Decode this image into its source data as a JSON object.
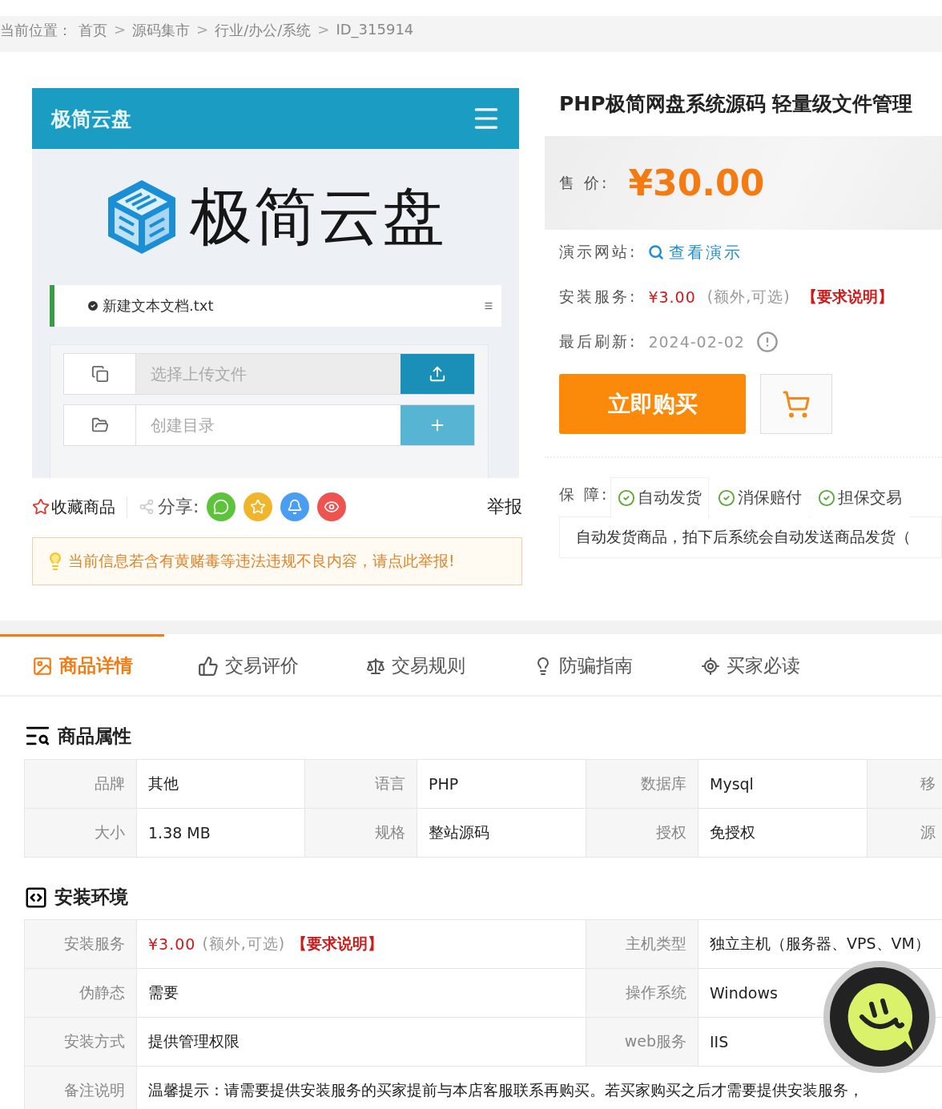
{
  "breadcrumb": {
    "label": "当前位置：",
    "items": [
      {
        "kind": "link",
        "text": "首页"
      },
      {
        "kind": "sep",
        "text": ">"
      },
      {
        "kind": "link",
        "text": "源码集市"
      },
      {
        "kind": "sep",
        "text": ">"
      },
      {
        "kind": "link",
        "text": "行业/办公/系统"
      },
      {
        "kind": "sep",
        "text": ">"
      },
      {
        "kind": "link",
        "text": "ID_315914"
      }
    ]
  },
  "preview": {
    "app_title": "极简云盘",
    "logo_text": "极简云盘",
    "notice": "新建文本文档.txt",
    "fields": [
      {
        "kind": "upload",
        "placeholder": "选择上传文件"
      },
      {
        "kind": "folder",
        "placeholder": "创建目录"
      }
    ]
  },
  "actions": {
    "favorite": "收藏商品",
    "share_label": "分享:",
    "share": [
      {
        "kind": "chat",
        "color": "#5cc33a"
      },
      {
        "kind": "star",
        "color": "#f0b52b"
      },
      {
        "kind": "bell",
        "color": "#4a9df0"
      },
      {
        "kind": "weibo",
        "color": "#ef5350"
      }
    ],
    "report": "举报",
    "warning": "当前信息若含有黄赌毒等违法违规不良内容，请点此举报!"
  },
  "product": {
    "title": "PHP极简网盘系统源码 轻量级文件管理",
    "price_label": "售 价:",
    "price": "¥30.00",
    "rows": [
      {
        "kind": "demo",
        "label": "演示网站:",
        "link": "查看演示"
      },
      {
        "kind": "install",
        "label": "安装服务:",
        "price": "¥3.00",
        "note": "(额外,可选)",
        "link": "【要求说明】"
      },
      {
        "kind": "refresh",
        "label": "最后刷新:",
        "date": "2024-02-02"
      }
    ],
    "buy": "立即购买",
    "guarantee_label": "保 障:",
    "guarantees": [
      {
        "label": "自动发货",
        "selected": true
      },
      {
        "label": "消保赔付",
        "selected": false
      },
      {
        "label": "担保交易",
        "selected": false
      }
    ],
    "guarantee_text": "自动发货商品，拍下后系统会自动发送商品发货（"
  },
  "tabs": [
    {
      "kind": "detail",
      "label": "商品详情",
      "selected": true
    },
    {
      "kind": "review",
      "label": "交易评价",
      "selected": false
    },
    {
      "kind": "rules",
      "label": "交易规则",
      "selected": false
    },
    {
      "kind": "guide",
      "label": "防骗指南",
      "selected": false
    },
    {
      "kind": "read",
      "label": "买家必读",
      "selected": false
    }
  ],
  "attributes": {
    "title": "商品属性",
    "rows": [
      [
        {
          "label": "品牌",
          "value": "其他"
        },
        {
          "label": "语言",
          "value": "PHP"
        },
        {
          "label": "数据库",
          "value": "Mysql"
        },
        {
          "label": "移"
        }
      ],
      [
        {
          "label": "大小",
          "value": "1.38 MB"
        },
        {
          "label": "规格",
          "value": "整站源码"
        },
        {
          "label": "授权",
          "value": "免授权"
        },
        {
          "label": "源"
        }
      ]
    ]
  },
  "environment": {
    "title": "安装环境",
    "rows": [
      [
        {
          "label": "安装服务",
          "kind": "price",
          "price": "¥3.00",
          "note": "(额外,可选)",
          "link": "【要求说明】"
        },
        {
          "label": "主机类型",
          "value": "独立主机（服务器、VPS、VM）"
        }
      ],
      [
        {
          "label": "伪静态",
          "value": "需要"
        },
        {
          "label": "操作系统",
          "value": "Windows"
        }
      ],
      [
        {
          "label": "安装方式",
          "value": "提供管理权限"
        },
        {
          "label": "web服务",
          "value": "IIS"
        }
      ]
    ],
    "note": {
      "label": "备注说明",
      "value": "温馨提示：请需要提供安装服务的买家提前与本店客服联系再购买。若买家购买之后才需要提供安装服务，"
    }
  }
}
